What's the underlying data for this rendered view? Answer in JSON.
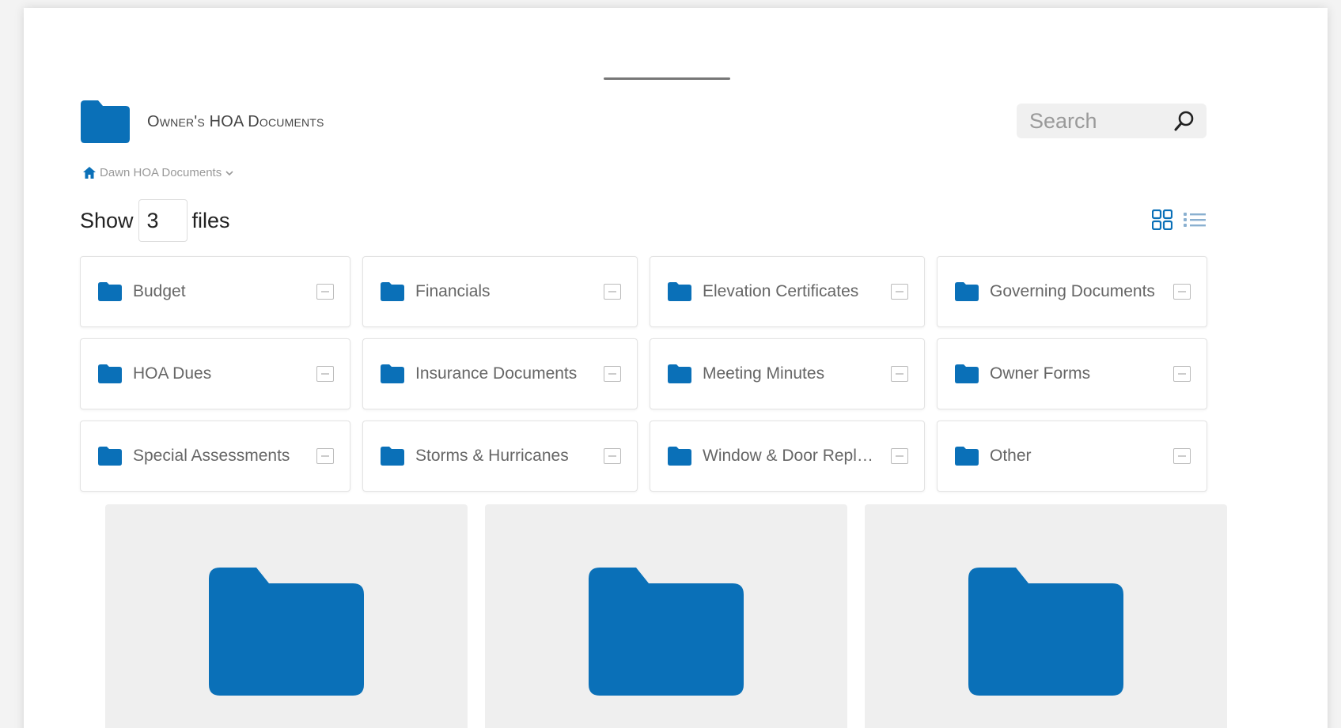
{
  "header": {
    "title": "Owner's HOA Documents"
  },
  "breadcrumb": {
    "label": "Dawn HOA Documents"
  },
  "search": {
    "placeholder": "Search"
  },
  "show_files": {
    "prefix": "Show",
    "value": "3",
    "suffix": "files"
  },
  "folders": [
    {
      "label": "Budget"
    },
    {
      "label": "Financials"
    },
    {
      "label": "Elevation Certificates"
    },
    {
      "label": "Governing Documents"
    },
    {
      "label": "HOA Dues"
    },
    {
      "label": "Insurance Documents"
    },
    {
      "label": "Meeting Minutes"
    },
    {
      "label": "Owner Forms"
    },
    {
      "label": "Special Assessments"
    },
    {
      "label": "Storms & Hurricanes"
    },
    {
      "label": "Window & Door Replacement"
    },
    {
      "label": "Other"
    }
  ],
  "icons": {
    "folder": "folder-icon",
    "home": "home-icon",
    "search": "search-icon",
    "grid_view": "grid-view-icon",
    "list_view": "list-view-icon"
  },
  "colors": {
    "accent": "#0a70b8",
    "panel": "#ffffff",
    "card": "#efefef"
  }
}
